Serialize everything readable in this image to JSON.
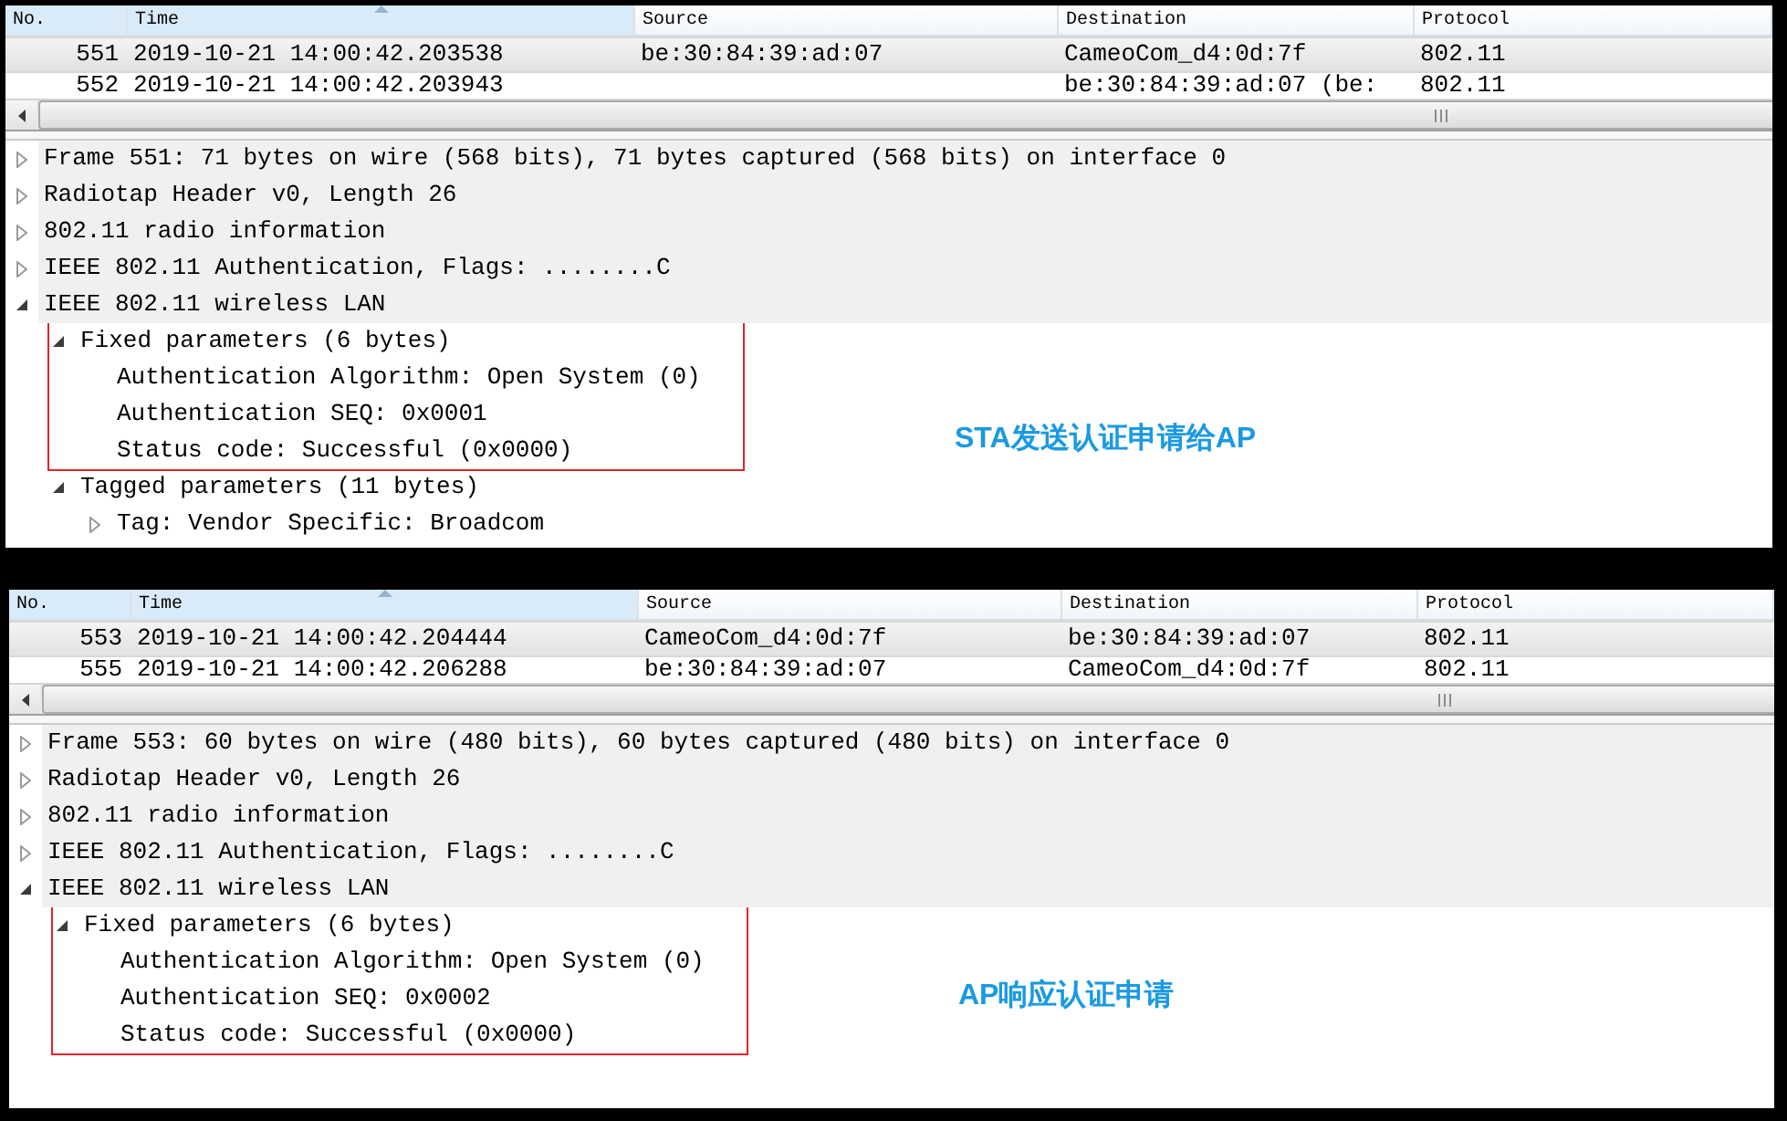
{
  "panels": [
    {
      "packet_list": {
        "columns": [
          {
            "label": "No.",
            "highlighted": true,
            "sorted": false
          },
          {
            "label": "Time",
            "highlighted": true,
            "sorted": true
          },
          {
            "label": "Source",
            "highlighted": false,
            "sorted": false
          },
          {
            "label": "Destination",
            "highlighted": false,
            "sorted": false
          },
          {
            "label": "Protocol",
            "highlighted": false,
            "sorted": false
          }
        ],
        "rows": [
          {
            "selected": true,
            "no": "551",
            "time": "2019-10-21 14:00:42.203538",
            "source": "be:30:84:39:ad:07",
            "destination": "CameoCom_d4:0d:7f",
            "protocol": "802.11"
          },
          {
            "selected": false,
            "no": "552",
            "time": "2019-10-21 14:00:42.203943",
            "destination": "be:30:84:39:ad:07 (be:",
            "protocol": "802.11"
          }
        ]
      },
      "details": {
        "tree": [
          {
            "label": "Frame 551: 71 bytes on wire (568 bits), 71 bytes captured (568 bits) on interface 0",
            "expanded": false,
            "boxed": false
          },
          {
            "label": "Radiotap Header v0, Length 26",
            "expanded": false,
            "boxed": false
          },
          {
            "label": "802.11 radio information",
            "expanded": false,
            "boxed": false
          },
          {
            "label": "IEEE 802.11 Authentication, Flags: ........C",
            "expanded": false,
            "boxed": false
          },
          {
            "label": "IEEE 802.11 wireless LAN",
            "expanded": true,
            "boxed": false,
            "children": [
              {
                "label": "Fixed parameters (6 bytes)",
                "expanded": true,
                "boxed": true,
                "children": [
                  {
                    "label": "Authentication Algorithm: Open System (0)"
                  },
                  {
                    "label": "Authentication SEQ: 0x0001"
                  },
                  {
                    "label": "Status code: Successful (0x0000)"
                  }
                ]
              },
              {
                "label": "Tagged parameters (11 bytes)",
                "expanded": true,
                "boxed": false,
                "children": [
                  {
                    "label": "Tag: Vendor Specific: Broadcom",
                    "expanded": false,
                    "boxed": false
                  }
                ]
              }
            ]
          }
        ]
      },
      "annotation": "STA发送认证申请给AP"
    },
    {
      "packet_list": {
        "columns": [
          {
            "label": "No.",
            "highlighted": true,
            "sorted": false
          },
          {
            "label": "Time",
            "highlighted": true,
            "sorted": true
          },
          {
            "label": "Source",
            "highlighted": false,
            "sorted": false
          },
          {
            "label": "Destination",
            "highlighted": false,
            "sorted": false
          },
          {
            "label": "Protocol",
            "highlighted": false,
            "sorted": false
          }
        ],
        "rows": [
          {
            "selected": true,
            "no": "553",
            "time": "2019-10-21 14:00:42.204444",
            "source": "CameoCom_d4:0d:7f",
            "destination": "be:30:84:39:ad:07",
            "protocol": "802.11"
          },
          {
            "selected": false,
            "no": "555",
            "time": "2019-10-21 14:00:42.206288",
            "source": "be:30:84:39:ad:07",
            "destination": "CameoCom_d4:0d:7f",
            "protocol": "802.11"
          }
        ]
      },
      "details": {
        "tree": [
          {
            "label": "Frame 553: 60 bytes on wire (480 bits), 60 bytes captured (480 bits) on interface 0",
            "expanded": false,
            "boxed": false
          },
          {
            "label": "Radiotap Header v0, Length 26",
            "expanded": false,
            "boxed": false
          },
          {
            "label": "802.11 radio information",
            "expanded": false,
            "boxed": false
          },
          {
            "label": "IEEE 802.11 Authentication, Flags: ........C",
            "expanded": false,
            "boxed": false
          },
          {
            "label": "IEEE 802.11 wireless LAN",
            "expanded": true,
            "boxed": false,
            "children": [
              {
                "label": "Fixed parameters (6 bytes)",
                "expanded": true,
                "boxed": true,
                "children": [
                  {
                    "label": "Authentication Algorithm: Open System (0)"
                  },
                  {
                    "label": "Authentication SEQ: 0x0002"
                  },
                  {
                    "label": "Status code: Successful (0x0000)"
                  }
                ]
              }
            ]
          }
        ]
      },
      "annotation": "AP响应认证申请"
    }
  ]
}
